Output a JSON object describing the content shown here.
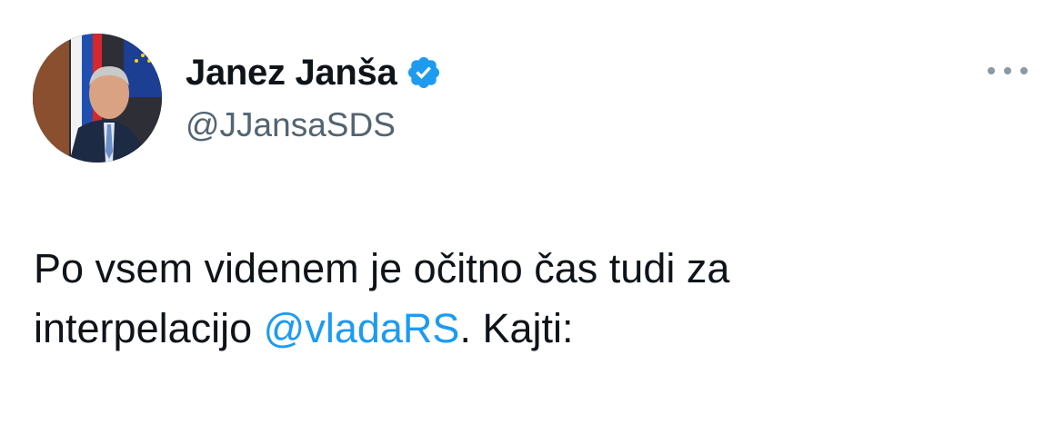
{
  "author": {
    "display_name": "Janez Janša",
    "handle": "@JJansaSDS",
    "verified": true,
    "avatar_icon": "profile-photo"
  },
  "menu": {
    "icon": "more-options-icon"
  },
  "tweet": {
    "line1": "Po vsem videnem je očitno čas tudi za",
    "line2_before": "interpelacijo ",
    "mention": "@vladaRS",
    "line2_after": ". Kajti:"
  },
  "colors": {
    "text": "#0f1419",
    "secondary": "#536471",
    "accent": "#1d9bf0"
  }
}
